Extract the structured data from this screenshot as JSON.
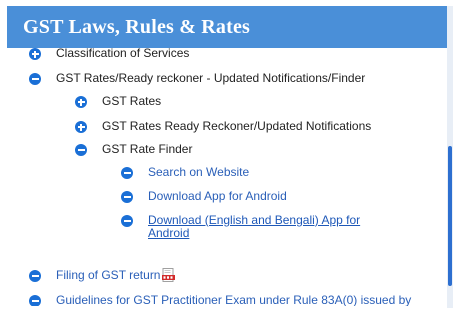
{
  "header": {
    "title": "GST Laws, Rules & Rates"
  },
  "items": {
    "classification": {
      "label": "Classification of Services",
      "state": "collapsed"
    },
    "rates_reckoner": {
      "label": "GST Rates/Ready reckoner - Updated Notifications/Finder",
      "state": "expanded"
    },
    "gst_rates": {
      "label": "GST Rates",
      "state": "collapsed"
    },
    "ready_reckoner": {
      "label": "GST Rates Ready Reckoner/Updated Notifications",
      "state": "collapsed"
    },
    "rate_finder": {
      "label": "GST Rate Finder",
      "state": "expanded"
    },
    "search_website": {
      "label": "Search on Website"
    },
    "download_android": {
      "label": "Download App for Android"
    },
    "download_bengali_line1": {
      "label": "Download (English and Bengali) App for"
    },
    "download_bengali_line2": {
      "label": "Android"
    },
    "filing": {
      "label": "Filing of GST return",
      "icon": "pdf-icon"
    },
    "guidelines": {
      "label": "Guidelines for GST Practitioner Exam under Rule 83A(0) issued by"
    }
  },
  "colors": {
    "header_bg": "#4a8fd8",
    "icon_blue": "#1a6fd6",
    "link_blue": "#1e58b8",
    "scrollbar": "#2d6fd0"
  }
}
